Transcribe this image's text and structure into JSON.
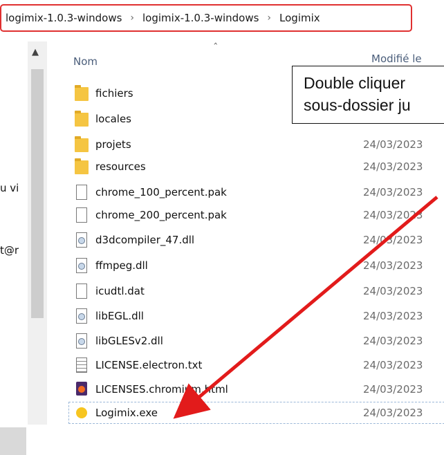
{
  "breadcrumb": {
    "segments": [
      "logimix-1.0.3-windows",
      "logimix-1.0.3-windows",
      "Logimix"
    ],
    "separator": "›"
  },
  "sidebar": {
    "texts": [
      "u vi",
      "t@r"
    ]
  },
  "columns": {
    "name": "Nom",
    "modified": "Modifié le"
  },
  "files": [
    {
      "name": "fichiers",
      "date": "",
      "icon": "folder-icon"
    },
    {
      "name": "locales",
      "date": "",
      "icon": "folder-icon"
    },
    {
      "name": "projets",
      "date": "24/03/2023",
      "icon": "folder-icon"
    },
    {
      "name": "resources",
      "date": "24/03/2023",
      "icon": "folder-icon"
    },
    {
      "name": "chrome_100_percent.pak",
      "date": "24/03/2023",
      "icon": "file-icon"
    },
    {
      "name": "chrome_200_percent.pak",
      "date": "24/03/2023",
      "icon": "file-icon"
    },
    {
      "name": "d3dcompiler_47.dll",
      "date": "24/03/2023",
      "icon": "dll-icon"
    },
    {
      "name": "ffmpeg.dll",
      "date": "24/03/2023",
      "icon": "dll-icon"
    },
    {
      "name": "icudtl.dat",
      "date": "24/03/2023",
      "icon": "file-icon"
    },
    {
      "name": "libEGL.dll",
      "date": "24/03/2023",
      "icon": "dll-icon"
    },
    {
      "name": "libGLESv2.dll",
      "date": "24/03/2023",
      "icon": "dll-icon"
    },
    {
      "name": "LICENSE.electron.txt",
      "date": "24/03/2023",
      "icon": "text-file-icon"
    },
    {
      "name": "LICENSES.chromium.html",
      "date": "24/03/2023",
      "icon": "html-file-icon"
    },
    {
      "name": "Logimix.exe",
      "date": "24/03/2023",
      "icon": "exe-icon"
    }
  ],
  "annotation": {
    "line1": "Double cliquer",
    "line2": "sous-dossier ju"
  },
  "colors": {
    "highlight_border": "#e03030",
    "arrow": "#e21b1b"
  }
}
